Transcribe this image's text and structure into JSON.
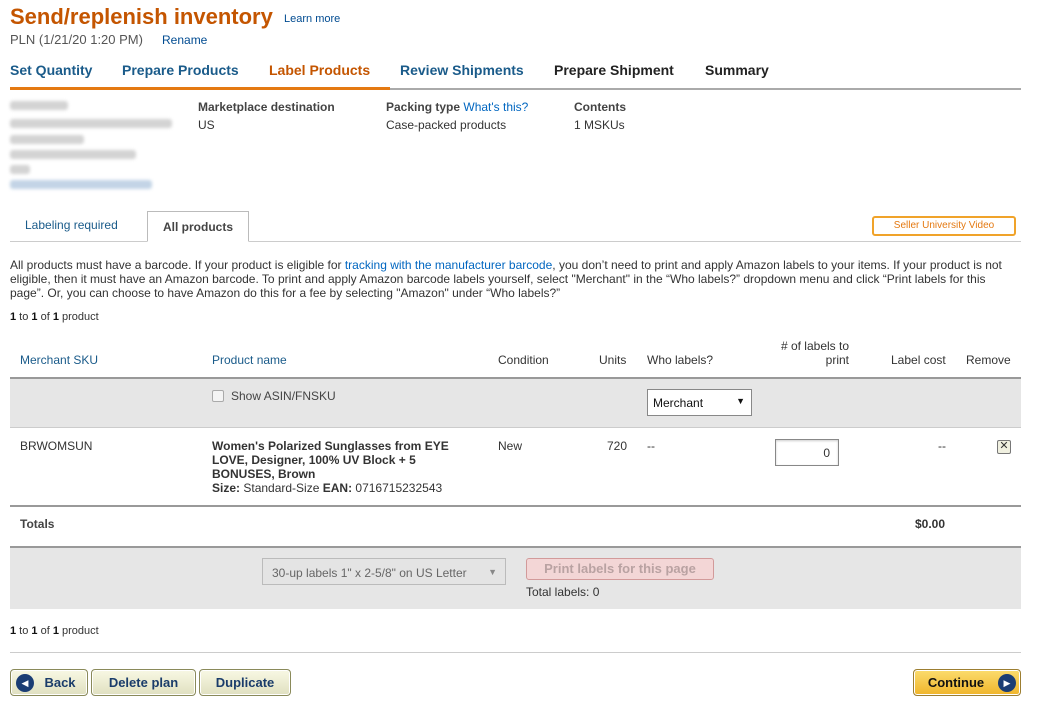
{
  "header": {
    "title": "Send/replenish inventory",
    "learn_more": "Learn more",
    "plan": "PLN (1/21/20 1:20 PM)",
    "rename": "Rename"
  },
  "steps": [
    {
      "label": "Set Quantity",
      "state": "done"
    },
    {
      "label": "Prepare Products",
      "state": "done"
    },
    {
      "label": "Label Products",
      "state": "active"
    },
    {
      "label": "Review Shipments",
      "state": "done"
    },
    {
      "label": "Prepare Shipment",
      "state": "future"
    },
    {
      "label": "Summary",
      "state": "future"
    }
  ],
  "shipment_info": {
    "marketplace_label": "Marketplace destination",
    "marketplace_value": "US",
    "packing_label": "Packing type",
    "packing_help": "What's this?",
    "packing_value": "Case-packed products",
    "contents_label": "Contents",
    "contents_value": "1 MSKUs"
  },
  "subtabs": {
    "labeling_required": "Labeling required",
    "all_products": "All products",
    "seller_video": "Seller University Video"
  },
  "info": {
    "text_before_link": "All products must have a barcode. If your product is eligible for ",
    "link": "tracking with the manufacturer barcode",
    "text_after_link": ", you don’t need to print and apply Amazon labels to your items.  If your product is not eligible, then it must have an Amazon barcode. To print and apply Amazon barcode labels yourself, select \"Merchant\" in the “Who labels?” dropdown menu and click “Print labels for this page”. Or, you can choose to have Amazon do this for a fee by selecting \"Amazon\" under “Who labels?”"
  },
  "pager": {
    "from": "1",
    "to_word": " to ",
    "to": "1",
    "of_word": " of ",
    "total": "1",
    "unit": " product"
  },
  "table": {
    "headers": {
      "sku": "Merchant SKU",
      "name": "Product name",
      "condition": "Condition",
      "units": "Units",
      "who": "Who labels?",
      "num_labels": "# of labels to print",
      "cost": "Label cost",
      "remove": "Remove"
    },
    "show_asin": "Show ASIN/FNSKU",
    "who_default": "Merchant",
    "rows": [
      {
        "sku": "BRWOMSUN",
        "name": "Women's Polarized Sunglasses from EYE LOVE, Designer, 100% UV Block + 5 BONUSES, Brown",
        "size_label": "Size:",
        "size_value": " Standard-Size ",
        "ean_label": "EAN:",
        "ean_value": " 0716715232543",
        "condition": "New",
        "units": "720",
        "who_labels": "--",
        "labels_to_print": "0",
        "label_cost": "--"
      }
    ],
    "totals_label": "Totals",
    "totals_value": "$0.00"
  },
  "print": {
    "label_format": "30-up labels 1\" x 2-5/8\" on US Letter",
    "button": "Print labels for this page",
    "total_labels": "Total labels: 0"
  },
  "buttons": {
    "back": "Back",
    "delete": "Delete plan",
    "duplicate": "Duplicate",
    "continue": "Continue"
  }
}
